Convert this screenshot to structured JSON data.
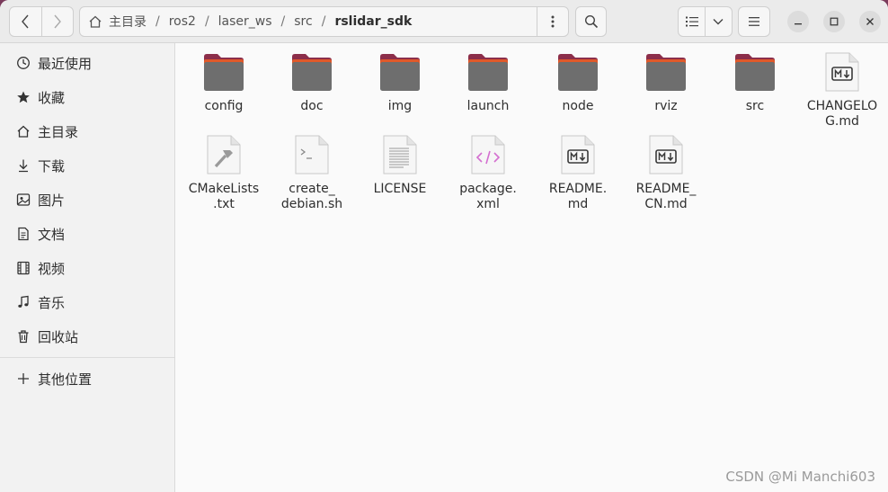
{
  "window": {
    "path": [
      "主目录",
      "ros2",
      "laser_ws",
      "src",
      "rslidar_sdk"
    ]
  },
  "sidebar": {
    "items": [
      {
        "label": "最近使用",
        "icon": "clock-icon"
      },
      {
        "label": "收藏",
        "icon": "star-icon"
      },
      {
        "label": "主目录",
        "icon": "home-icon"
      },
      {
        "label": "下载",
        "icon": "download-icon"
      },
      {
        "label": "图片",
        "icon": "image-icon"
      },
      {
        "label": "文档",
        "icon": "document-icon"
      },
      {
        "label": "视频",
        "icon": "video-icon"
      },
      {
        "label": "音乐",
        "icon": "music-icon"
      },
      {
        "label": "回收站",
        "icon": "trash-icon"
      },
      {
        "label": "其他位置",
        "icon": "plus-icon"
      }
    ]
  },
  "files": [
    {
      "name": "config",
      "type": "folder"
    },
    {
      "name": "doc",
      "type": "folder"
    },
    {
      "name": "img",
      "type": "folder"
    },
    {
      "name": "launch",
      "type": "folder"
    },
    {
      "name": "node",
      "type": "folder"
    },
    {
      "name": "rviz",
      "type": "folder"
    },
    {
      "name": "src",
      "type": "folder"
    },
    {
      "name": "CHANGELOG.md",
      "type": "markdown"
    },
    {
      "name": "CMakeLists.txt",
      "type": "cmake"
    },
    {
      "name": "create_debian.sh",
      "type": "script"
    },
    {
      "name": "LICENSE",
      "type": "text"
    },
    {
      "name": "package.xml",
      "type": "xml"
    },
    {
      "name": "README.md",
      "type": "markdown"
    },
    {
      "name": "README_CN.md",
      "type": "markdown"
    }
  ],
  "file_labels": [
    "config",
    "doc",
    "img",
    "launch",
    "node",
    "rviz",
    "src",
    "CHANGELO\nG.md",
    "CMakeLists\n.txt",
    "create_\ndebian.sh",
    "LICENSE",
    "package.\nxml",
    "README.\nmd",
    "README_\nCN.md"
  ],
  "watermark": "CSDN @Mi Manchi603",
  "colors": {
    "folder_top": "#e0592a",
    "folder_body": "#6e6e6e",
    "folder_back": "#8c2e4a",
    "desktop": "#7a3b5c"
  }
}
